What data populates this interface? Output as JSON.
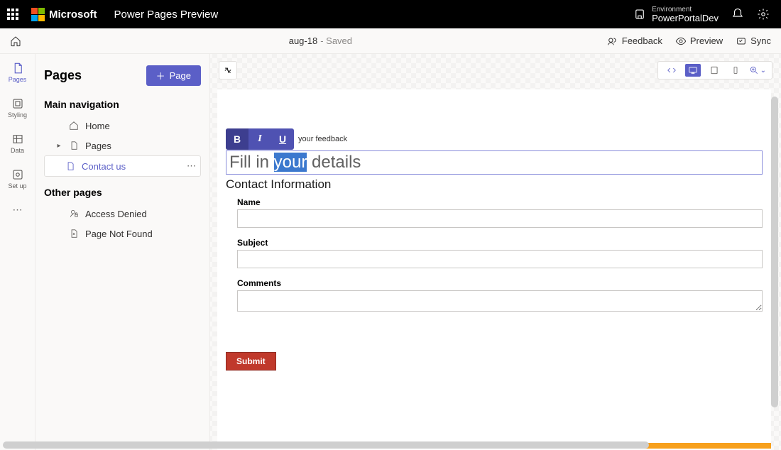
{
  "topbar": {
    "brand": "Microsoft",
    "product": "Power Pages Preview",
    "env_label": "Environment",
    "env_value": "PowerPortalDev"
  },
  "commandbar": {
    "doc_name": "aug-18",
    "status": "- Saved",
    "feedback": "Feedback",
    "preview": "Preview",
    "sync": "Sync"
  },
  "leftrail": {
    "pages": "Pages",
    "styling": "Styling",
    "data": "Data",
    "setup": "Set up"
  },
  "sidepanel": {
    "title": "Pages",
    "add_page": "Page",
    "main_nav": "Main navigation",
    "items": {
      "home": "Home",
      "pages": "Pages",
      "contact": "Contact us"
    },
    "other": "Other pages",
    "other_items": {
      "access": "Access Denied",
      "notfound": "Page Not Found"
    }
  },
  "canvas": {
    "toolbar_hint": "your feedback",
    "heading_pre": "Fill in ",
    "heading_sel": "your",
    "heading_post": " details",
    "subhead": "Contact Information",
    "name": "Name",
    "subject": "Subject",
    "comments": "Comments",
    "submit": "Submit"
  }
}
